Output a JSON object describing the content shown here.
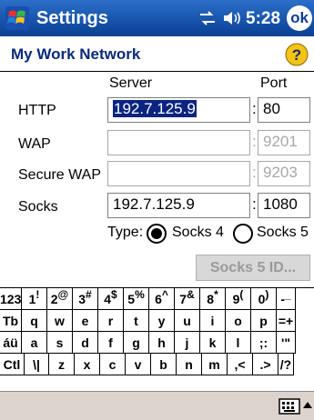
{
  "titlebar": {
    "title": "Settings",
    "time": "5:28",
    "ok_label": "ok"
  },
  "page": {
    "title": "My Work Network"
  },
  "columns": {
    "server": "Server",
    "port": "Port"
  },
  "rows": [
    {
      "label": "HTTP",
      "server": "192.7.125.9",
      "port": "80",
      "enabled": true,
      "selected": true
    },
    {
      "label": "WAP",
      "server": "",
      "port": "9201",
      "enabled": false
    },
    {
      "label": "Secure WAP",
      "server": "",
      "port": "9203",
      "enabled": false
    },
    {
      "label": "Socks",
      "server": "192.7.125.9",
      "port": "1080",
      "enabled": true
    }
  ],
  "socks_type": {
    "label": "Type:",
    "options": [
      "Socks 4",
      "Socks 5"
    ],
    "selected": "Socks 4"
  },
  "socks5_button": "Socks 5 ID...",
  "keyboard": {
    "row1": [
      {
        "main": "123",
        "shift": ""
      },
      {
        "main": "1",
        "shift": "!"
      },
      {
        "main": "2",
        "shift": "@"
      },
      {
        "main": "3",
        "shift": "#"
      },
      {
        "main": "4",
        "shift": "$"
      },
      {
        "main": "5",
        "shift": "%"
      },
      {
        "main": "6",
        "shift": "^"
      },
      {
        "main": "7",
        "shift": "&"
      },
      {
        "main": "8",
        "shift": "*"
      },
      {
        "main": "9",
        "shift": "("
      },
      {
        "main": "0",
        "shift": ")"
      },
      {
        "main": "-",
        "shift": "_"
      }
    ],
    "row2": [
      "Tb",
      "q",
      "w",
      "e",
      "r",
      "t",
      "y",
      "u",
      "i",
      "o",
      "p",
      "=+"
    ],
    "row3": [
      "áü",
      "a",
      "s",
      "d",
      "f",
      "g",
      "h",
      "j",
      "k",
      "l",
      ";:",
      "'\""
    ],
    "row4": [
      "Ctl",
      "\\|",
      "z",
      "x",
      "c",
      "v",
      "b",
      "n",
      "m",
      ",<",
      ".>",
      "/?"
    ]
  },
  "icons": {
    "start": "windows-flag-icon",
    "connectivity": "connectivity-arrows-icon",
    "volume": "speaker-icon",
    "help": "help-icon",
    "keyboard": "keyboard-icon"
  }
}
